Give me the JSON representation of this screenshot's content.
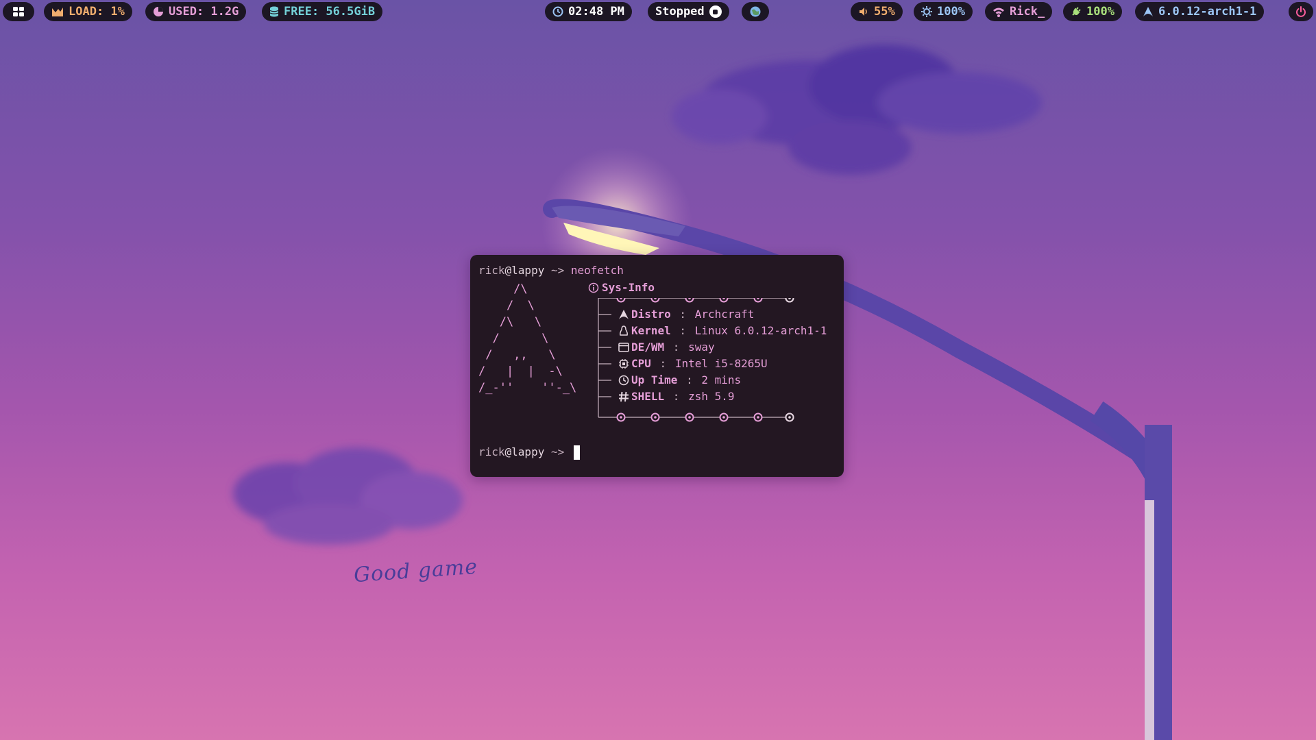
{
  "topbar": {
    "workspaces_icon": "grid-icon",
    "load": {
      "icon": "chart-icon",
      "label": "LOAD: 1%"
    },
    "used": {
      "icon": "pie-icon",
      "label": "USED: 1.2G"
    },
    "free": {
      "icon": "database-icon",
      "label": "FREE: 56.5GiB"
    },
    "clock": {
      "icon": "clock-icon",
      "label": "02:48 PM"
    },
    "media": {
      "label": "Stopped",
      "icon": "stop-icon"
    },
    "app_icon": "globe-icon",
    "volume": {
      "icon": "speaker-icon",
      "label": "55%"
    },
    "brightness": {
      "icon": "sun-icon",
      "label": "100%"
    },
    "network": {
      "icon": "wifi-icon",
      "label": "Rick_"
    },
    "battery": {
      "icon": "plug-icon",
      "label": "100%"
    },
    "kernel": {
      "icon": "arch-icon",
      "label": "6.0.12-arch1-1"
    },
    "power_icon": "power-icon"
  },
  "terminal": {
    "prompt_user": "rick",
    "prompt_host": "@lappy",
    "prompt_path": " ~> ",
    "command": "neofetch",
    "ascii_art": "     /\\\n    /  \\\n   /\\   \\\n  /      \\\n /   ,,   \\\n/   |  |  -\\\n/_-''    ''-_\\",
    "sysinfo_title": "Sys-Info",
    "info": [
      {
        "icon": "arch-icon",
        "key": "Distro",
        "sep": " : ",
        "value": "Archcraft"
      },
      {
        "icon": "linux-icon",
        "key": "Kernel",
        "sep": " : ",
        "value": "Linux 6.0.12-arch1-1"
      },
      {
        "icon": "window-icon",
        "key": "DE/WM",
        "sep": " : ",
        "value": "sway"
      },
      {
        "icon": "cpu-icon",
        "key": "CPU",
        "sep": " : ",
        "value": "Intel i5-8265U"
      },
      {
        "icon": "clock-icon",
        "key": "Up Time",
        "sep": " : ",
        "value": "2 mins"
      },
      {
        "icon": "hash-icon",
        "key": "SHELL",
        "sep": " : ",
        "value": "zsh 5.9"
      }
    ]
  },
  "wallpaper": {
    "caption": "Good game"
  },
  "colors": {
    "bar_pill": "#1c1624",
    "terminal_bg": "#231722",
    "accent_pink": "#e59ed7",
    "load_orange": "#f0ad6e",
    "free_cyan": "#74d0d8",
    "battery_green": "#a9e07c",
    "power_red": "#ff5e9c"
  }
}
